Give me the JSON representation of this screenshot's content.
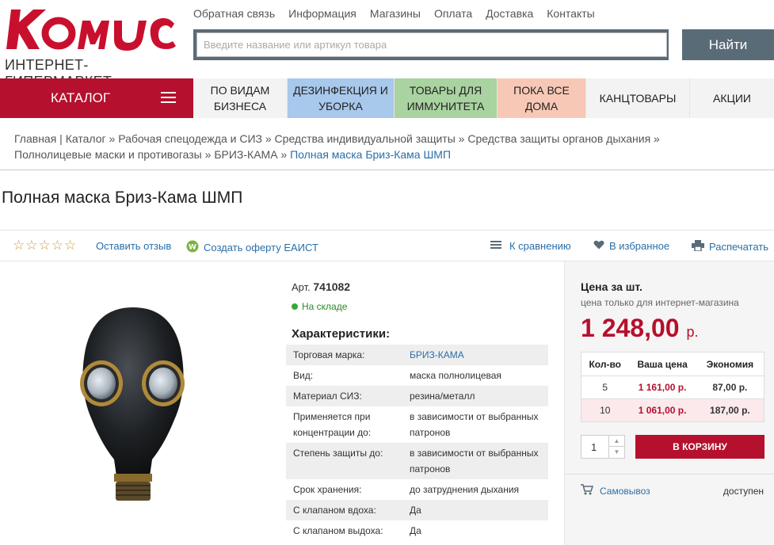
{
  "logo": {
    "brand": "Комус",
    "subtitle": "ИНТЕРНЕТ-ГИПЕРМАРКЕТ"
  },
  "topnav": [
    "Обратная связь",
    "Информация",
    "Магазины",
    "Оплата",
    "Доставка",
    "Контакты"
  ],
  "search": {
    "placeholder": "Введите название или артикул товара",
    "button": "Найти"
  },
  "catalog_label": "КАТАЛОГ",
  "categories": [
    {
      "line1": "ПО ВИДАМ",
      "line2": "БИЗНЕСА"
    },
    {
      "line1": "ДЕЗИНФЕКЦИЯ И",
      "line2": "УБОРКА"
    },
    {
      "line1": "ТОВАРЫ ДЛЯ",
      "line2": "ИММУНИТЕТА"
    },
    {
      "line1": "ПОКА ВСЕ",
      "line2": "ДОМА"
    },
    {
      "line1": "КАНЦТОВАРЫ",
      "line2": ""
    },
    {
      "line1": "АКЦИИ",
      "line2": ""
    }
  ],
  "breadcrumb": {
    "items": [
      "Главная",
      "Каталог",
      "Рабочая спецодежда и СИЗ",
      "Средства индивидуальной защиты",
      "Средства защиты органов дыхания",
      "Полнолицевые маски и противогазы",
      "БРИЗ-КАМА"
    ],
    "current": "Полная маска Бриз-Кама ШМП"
  },
  "product": {
    "title": "Полная маска Бриз-Кама ШМП",
    "art_label": "Арт.",
    "art": "741082",
    "stock": "На складе"
  },
  "actions": {
    "stars": "☆☆☆☆☆",
    "review": "Оставить отзыв",
    "offer": "Создать оферту ЕАИСТ",
    "compare": "К сравнению",
    "favorite": "В избранное",
    "print": "Распечатать"
  },
  "characteristics": {
    "title": "Характеристики:",
    "rows": [
      {
        "k": "Торговая марка:",
        "v": "БРИЗ-КАМА"
      },
      {
        "k": "Вид:",
        "v": "маска полнолицевая"
      },
      {
        "k": "Материал СИЗ:",
        "v": "резина/металл"
      },
      {
        "k": "Применяется при концентрации до:",
        "v": "в зависимости от выбранных патронов"
      },
      {
        "k": "Степень защиты до:",
        "v": "в зависимости от выбранных патронов"
      },
      {
        "k": "Срок хранения:",
        "v": "до затруднения дыхания"
      },
      {
        "k": "С клапаном вдоха:",
        "v": "Да"
      },
      {
        "k": "С клапаном выдоха:",
        "v": "Да"
      }
    ]
  },
  "price": {
    "title": "Цена за шт.",
    "note": "цена только для интернет-магазина",
    "value": "1 248,00",
    "currency": "р.",
    "table_headers": [
      "Кол-во",
      "Ваша цена",
      "Экономия"
    ],
    "table_rows": [
      {
        "qty": "5",
        "price": "1 161,00 р.",
        "save": "87,00 р."
      },
      {
        "qty": "10",
        "price": "1 061,00 р.",
        "save": "187,00 р."
      }
    ],
    "qty": "1",
    "cart": "В КОРЗИНУ",
    "pickup": "Самовывоз",
    "pickup_status": "доступен"
  },
  "colors": {
    "brand_red": "#b5102d",
    "link": "#2a6fa8",
    "search_bg": "#5a6b78"
  }
}
